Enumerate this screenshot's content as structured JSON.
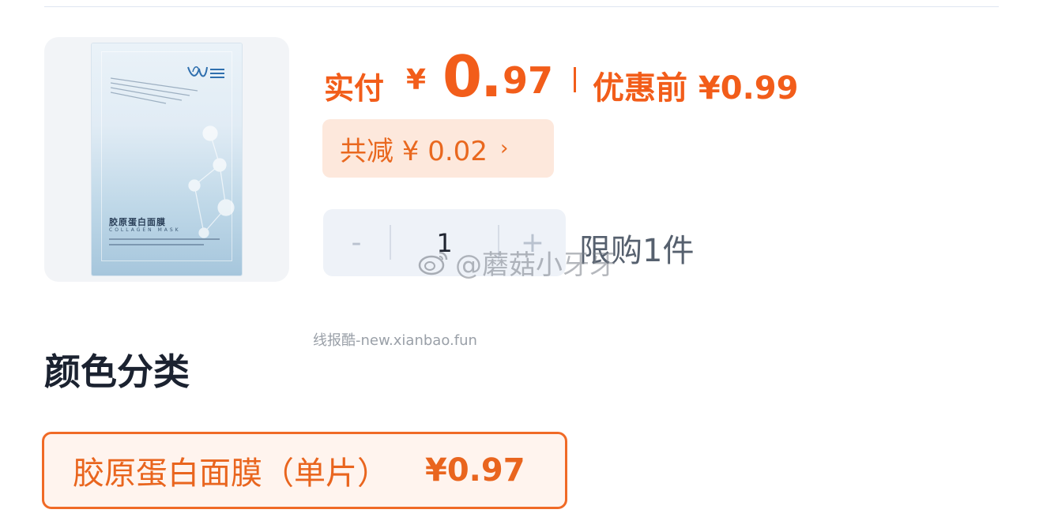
{
  "product": {
    "image_alt": "胶原蛋白面膜",
    "pack_title": "胶原蛋白面膜",
    "pack_subtitle": "COLLAGEN MASK"
  },
  "price": {
    "pay_label": "实付",
    "currency": "¥",
    "pay_integer": "0.",
    "pay_decimal": "97",
    "original_label": "优惠前 ¥0.99",
    "discount_text": "共减 ¥ 0.02",
    "discount_chevron": "›"
  },
  "quantity": {
    "minus": "-",
    "value": "1",
    "plus": "+",
    "limit": "限购1件"
  },
  "watermarks": {
    "weibo": "@蘑菇小牙牙",
    "site": "线报酷-new.xianbao.fun"
  },
  "variants": {
    "section_title": "颜色分类",
    "items": [
      {
        "label": "胶原蛋白面膜（单片）",
        "price": "¥0.97"
      }
    ]
  },
  "colors": {
    "accent": "#f25d1a",
    "chip_bg": "#fde8dc",
    "stepper_bg": "#eef2f8"
  }
}
